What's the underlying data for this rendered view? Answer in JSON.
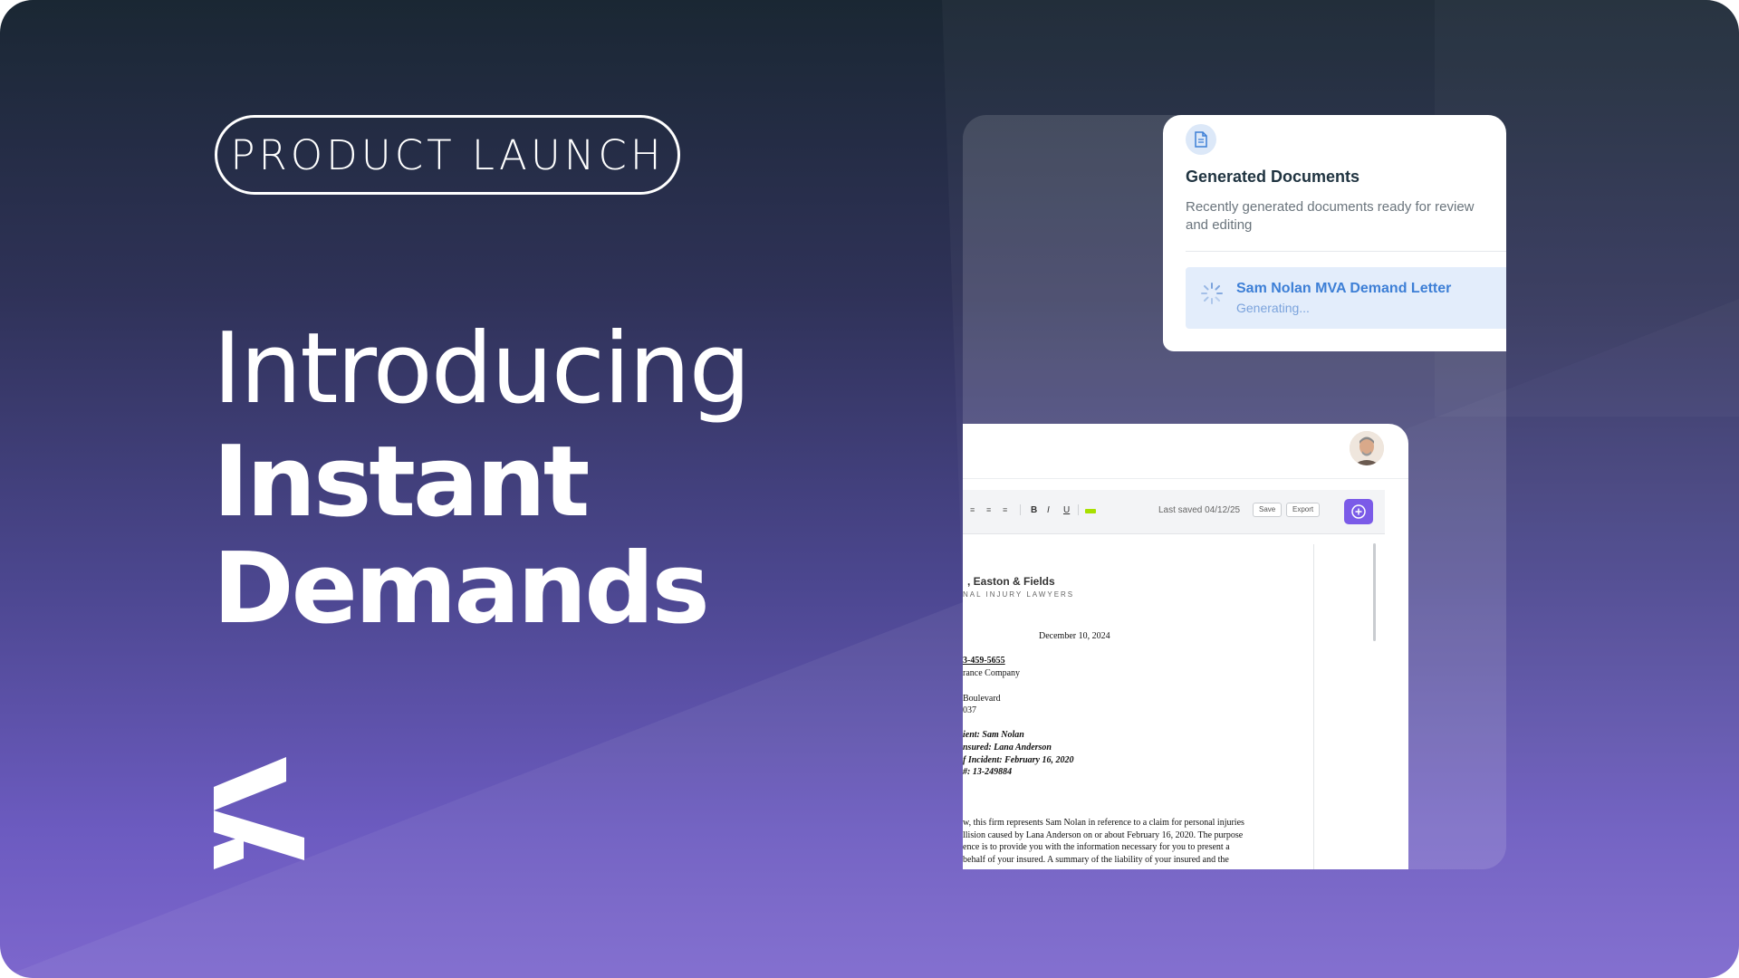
{
  "badge": "PRODUCT LAUNCH",
  "headline": {
    "line1": "Introducing",
    "line2": "Instant",
    "line3": "Demands"
  },
  "colors": {
    "gradient_top": "#1a2733",
    "gradient_bottom": "#7d67cd",
    "accent_purple": "#7b5be8",
    "link_blue": "#3d7fd6",
    "highlight_green": "#a8e000"
  },
  "icons": {
    "brand_logo": "brand-logo-icon",
    "document": "document-icon",
    "spinner": "loading-spinner-icon",
    "assistant": "ai-assistant-icon",
    "avatar": "user-avatar"
  },
  "generated_documents": {
    "title": "Generated Documents",
    "subtitle": "Recently generated documents ready for review and editing",
    "items": [
      {
        "title": "Sam Nolan MVA Demand Letter",
        "status": "Generating..."
      }
    ]
  },
  "editor": {
    "toolbar": {
      "bold": "B",
      "italic": "I",
      "underline": "U",
      "last_saved": "Last saved 04/12/25",
      "save": "Save",
      "export": "Export"
    },
    "letter": {
      "firm_name": ", Easton & Fields",
      "firm_tagline": "NAL INJURY LAWYERS",
      "date": "December 10, 2024",
      "recipient": [
        "3-459-5655",
        "rance Company",
        "Boulevard",
        "037"
      ],
      "re": [
        "ient: Sam Nolan",
        "nsured: Lana Anderson",
        "f Incident: February 16, 2020",
        "#: 13-249884"
      ],
      "body": [
        "w, this firm represents Sam Nolan in reference to a claim for personal injuries",
        "llision caused by Lana Anderson on or about February 16, 2020. The purpose",
        "ence is to provide you with the information necessary for you to present a",
        "behalf of your insured. A summary of the liability of your insured and the"
      ]
    }
  }
}
